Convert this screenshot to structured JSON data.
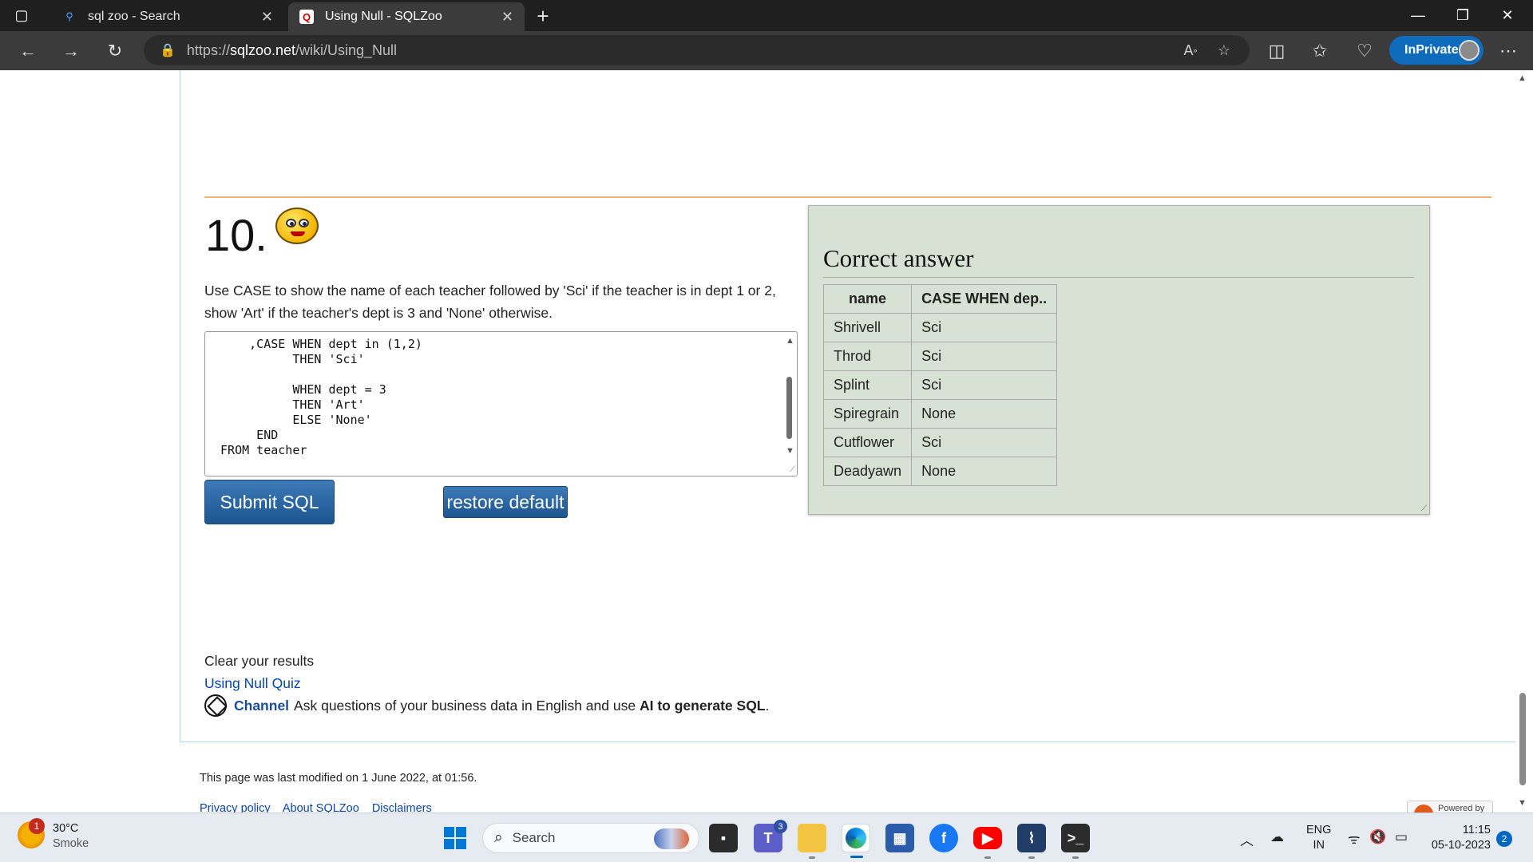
{
  "browser": {
    "tabs": [
      {
        "title": "sql zoo - Search",
        "icon": "search-icon",
        "active": false
      },
      {
        "title": "Using Null - SQLZoo",
        "icon": "sqlzoo-favicon",
        "active": true
      }
    ],
    "address": {
      "url_prefix": "https://",
      "url_host": "sqlzoo.net",
      "url_path": "/wiki/Using_Null"
    },
    "inprivate_label": "InPrivate"
  },
  "page": {
    "question_number": "10.",
    "question_text": "Use CASE to show the name of each teacher followed by 'Sci' if the teacher is in dept 1 or 2, show 'Art' if the teacher's dept is 3 and 'None' otherwise.",
    "sql_code": "     ,CASE WHEN dept in (1,2)\n           THEN 'Sci'\n\n           WHEN dept = 3\n           THEN 'Art'\n           ELSE 'None'\n      END\n FROM teacher",
    "submit_label": "Submit SQL",
    "restore_label": "restore default",
    "answer": {
      "heading": "Correct answer",
      "columns": [
        "name",
        "CASE WHEN dep.."
      ],
      "rows": [
        [
          "Shrivell",
          "Sci"
        ],
        [
          "Throd",
          "Sci"
        ],
        [
          "Splint",
          "Sci"
        ],
        [
          "Spiregrain",
          "None"
        ],
        [
          "Cutflower",
          "Sci"
        ],
        [
          "Deadyawn",
          "None"
        ]
      ]
    },
    "clear_results": "Clear your results",
    "quiz_link": "Using Null Quiz",
    "channel": {
      "name": "Channel",
      "text": "Ask questions of your business data in English and use",
      "bold": "AI to generate SQL",
      "end": "."
    },
    "footer": {
      "modified": "This page was last modified on 1 June 2022, at 01:56.",
      "links": [
        "Privacy policy",
        "About SQLZoo",
        "Disclaimers"
      ],
      "powered": "Powered by"
    }
  },
  "taskbar": {
    "weather": {
      "temp": "30°C",
      "condition": "Smoke",
      "badge": "1"
    },
    "search_placeholder": "Search",
    "teams_badge": "3",
    "lang_line1": "ENG",
    "lang_line2": "IN",
    "time": "11:15",
    "date": "05-10-2023",
    "notifications": "2"
  }
}
